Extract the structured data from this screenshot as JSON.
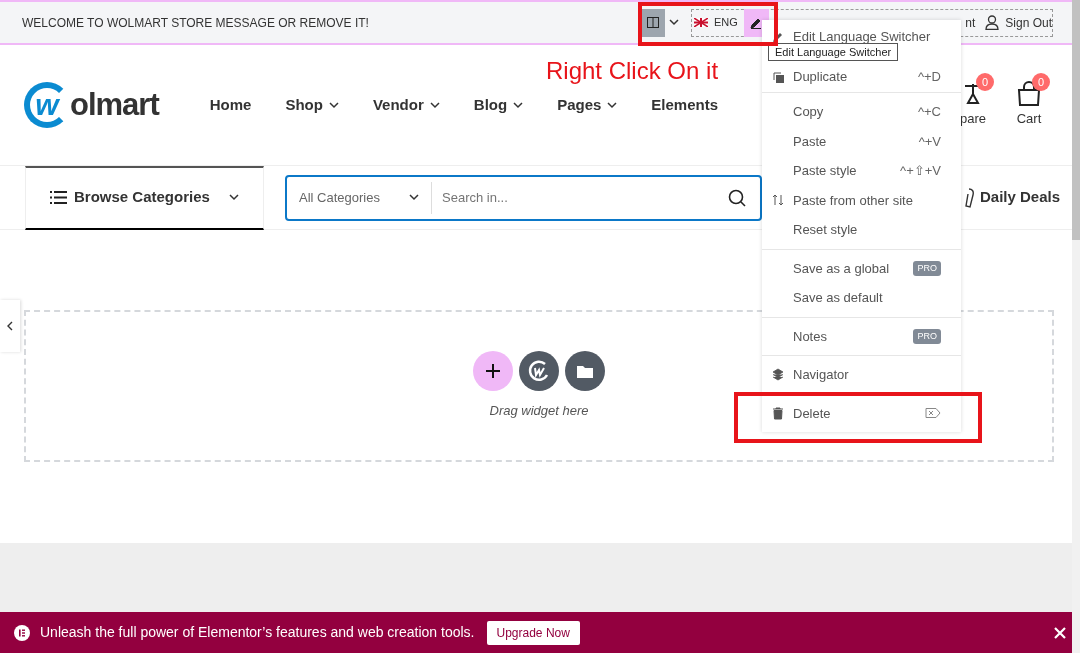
{
  "top_bar": {
    "welcome": "WELCOME TO WOLMART STORE MESSAGE OR REMOVE IT!",
    "language": "ENG",
    "account_fragment": "nt",
    "sign_out": "Sign Out"
  },
  "annotation": "Right Click On it",
  "tooltip": "Edit Language Switcher",
  "logo": {
    "mark": "w",
    "text": "olmart"
  },
  "nav": [
    {
      "label": "Home",
      "dropdown": false
    },
    {
      "label": "Shop",
      "dropdown": true
    },
    {
      "label": "Vendor",
      "dropdown": true
    },
    {
      "label": "Blog",
      "dropdown": true
    },
    {
      "label": "Pages",
      "dropdown": true
    },
    {
      "label": "Elements",
      "dropdown": false
    }
  ],
  "header_actions": [
    {
      "kind": "compare",
      "label": "pare",
      "count": "0"
    },
    {
      "kind": "cart",
      "label": "Cart",
      "count": "0"
    }
  ],
  "categories_button": "Browse Categories",
  "search": {
    "category": "All Categories",
    "placeholder": "Search in..."
  },
  "daily_deals": "Daily Deals",
  "drop_zone": {
    "hint": "Drag widget here"
  },
  "context_menu": {
    "groups": [
      [
        {
          "label": "Edit Language Switcher",
          "kind": "edit"
        },
        {
          "label": "Duplicate",
          "kind": "duplicate",
          "shortcut": "^+D"
        }
      ],
      [
        {
          "label": "Copy",
          "shortcut": "^+C"
        },
        {
          "label": "Paste",
          "shortcut": "^+V"
        },
        {
          "label": "Paste style",
          "shortcut": "^+⇧+V"
        },
        {
          "label": "Paste from other site",
          "kind": "paste-external"
        },
        {
          "label": "Reset style"
        }
      ],
      [
        {
          "label": "Save as a global",
          "badge": "PRO"
        },
        {
          "label": "Save as default"
        }
      ],
      [
        {
          "label": "Notes",
          "badge": "PRO"
        }
      ],
      [
        {
          "label": "Navigator",
          "kind": "navigator"
        }
      ],
      [
        {
          "label": "Delete",
          "kind": "delete"
        }
      ]
    ]
  },
  "notice": {
    "text": "Unleash the full power of Elementor’s features and web creation tools.",
    "button": "Upgrade Now"
  }
}
